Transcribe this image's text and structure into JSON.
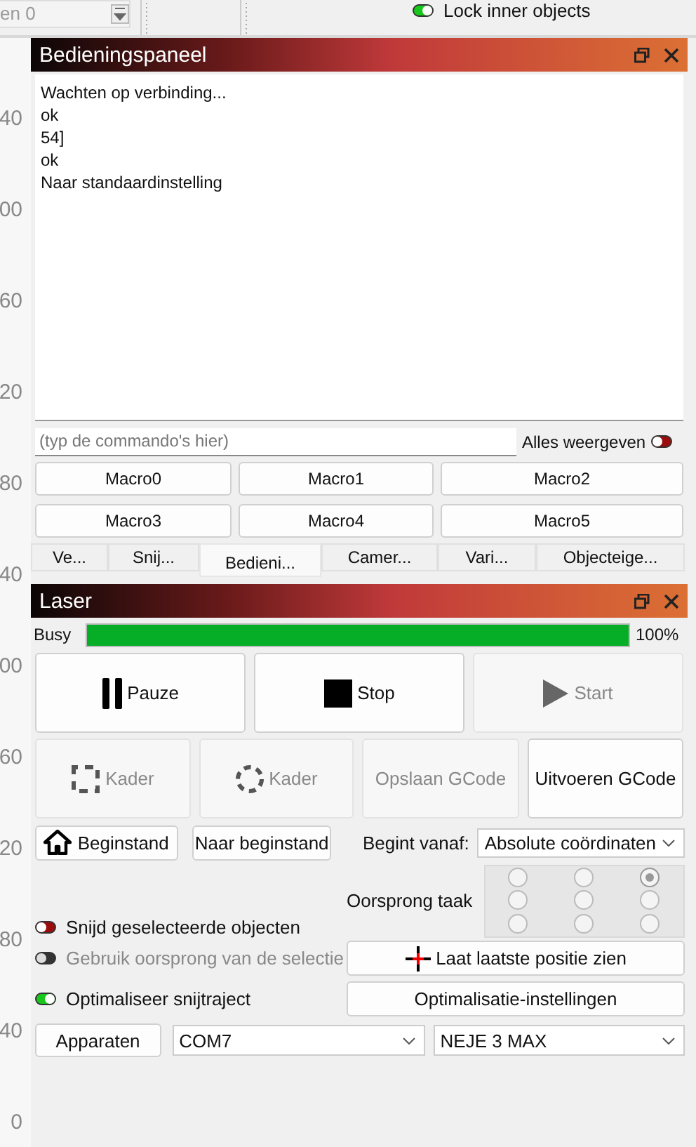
{
  "top_bar": {
    "spin_field": {
      "value": "en 0"
    },
    "lock_inner": {
      "label": "Lock inner objects",
      "on": true
    }
  },
  "ruler": {
    "labels": [
      "40",
      "00",
      "60",
      "20",
      "80",
      "40",
      "00",
      "60",
      "20",
      "80",
      "40",
      "0"
    ]
  },
  "console_panel": {
    "title": "Bedieningspaneel",
    "lines": [
      "Wachten op verbinding...",
      "ok",
      "54]",
      "ok",
      "Naar standaardinstelling"
    ],
    "command": {
      "placeholder": "(typ de commando's hier)"
    },
    "show_all": {
      "label": "Alles weergeven",
      "on": false
    },
    "macros": [
      "Macro0",
      "Macro1",
      "Macro2",
      "Macro3",
      "Macro4",
      "Macro5"
    ]
  },
  "tabs": [
    {
      "label": "Ve...",
      "selected": false
    },
    {
      "label": "Snij...",
      "selected": false
    },
    {
      "label": "Bedieni...",
      "selected": true
    },
    {
      "label": "Camer...",
      "selected": false
    },
    {
      "label": "Vari...",
      "selected": false
    },
    {
      "label": "Objecteige...",
      "selected": false
    }
  ],
  "laser_panel": {
    "title": "Laser",
    "status": "Busy",
    "progress": {
      "level": 1,
      "reading": "100%"
    },
    "main_buttons": [
      {
        "label": "Pauze",
        "kind": "pause",
        "disabled": false
      },
      {
        "label": "Stop",
        "kind": "stop",
        "disabled": false
      },
      {
        "label": "Start",
        "kind": "play",
        "disabled": true
      }
    ],
    "tool_buttons": [
      {
        "label": "Kader",
        "kind": "square",
        "disabled": true
      },
      {
        "label": "Kader",
        "kind": "circle",
        "disabled": true
      },
      {
        "label": "Opslaan GCode",
        "kind": "text",
        "disabled": true
      },
      {
        "label": "Uitvoeren GCode",
        "kind": "text",
        "disabled": false
      }
    ],
    "home_button": "Beginstand",
    "go_home_button": "Naar beginstand",
    "start_from": {
      "label": "Begint vanaf:",
      "value": "Absolute coördinaten"
    },
    "origin": {
      "label": "Oorsprong taak",
      "positions": [
        {
          "selected": false
        },
        {
          "selected": false
        },
        {
          "selected": true
        },
        {
          "selected": false
        },
        {
          "selected": false
        },
        {
          "selected": false
        },
        {
          "selected": false
        },
        {
          "selected": false
        },
        {
          "selected": false
        }
      ]
    },
    "options": [
      {
        "label": "Snijd geselecteerde objecten",
        "on": false,
        "disabled": false
      },
      {
        "label": "Gebruik oorsprong van de selectie",
        "on": false,
        "disabled": true
      },
      {
        "label": "Optimaliseer snijtraject",
        "on": true,
        "disabled": false
      }
    ],
    "show_last_button": "Laat laatste positie zien",
    "optimize_settings_button": "Optimalisatie-instellingen",
    "devices_button": "Apparaten",
    "port": "COM7",
    "device": "NEJE 3 MAX"
  }
}
